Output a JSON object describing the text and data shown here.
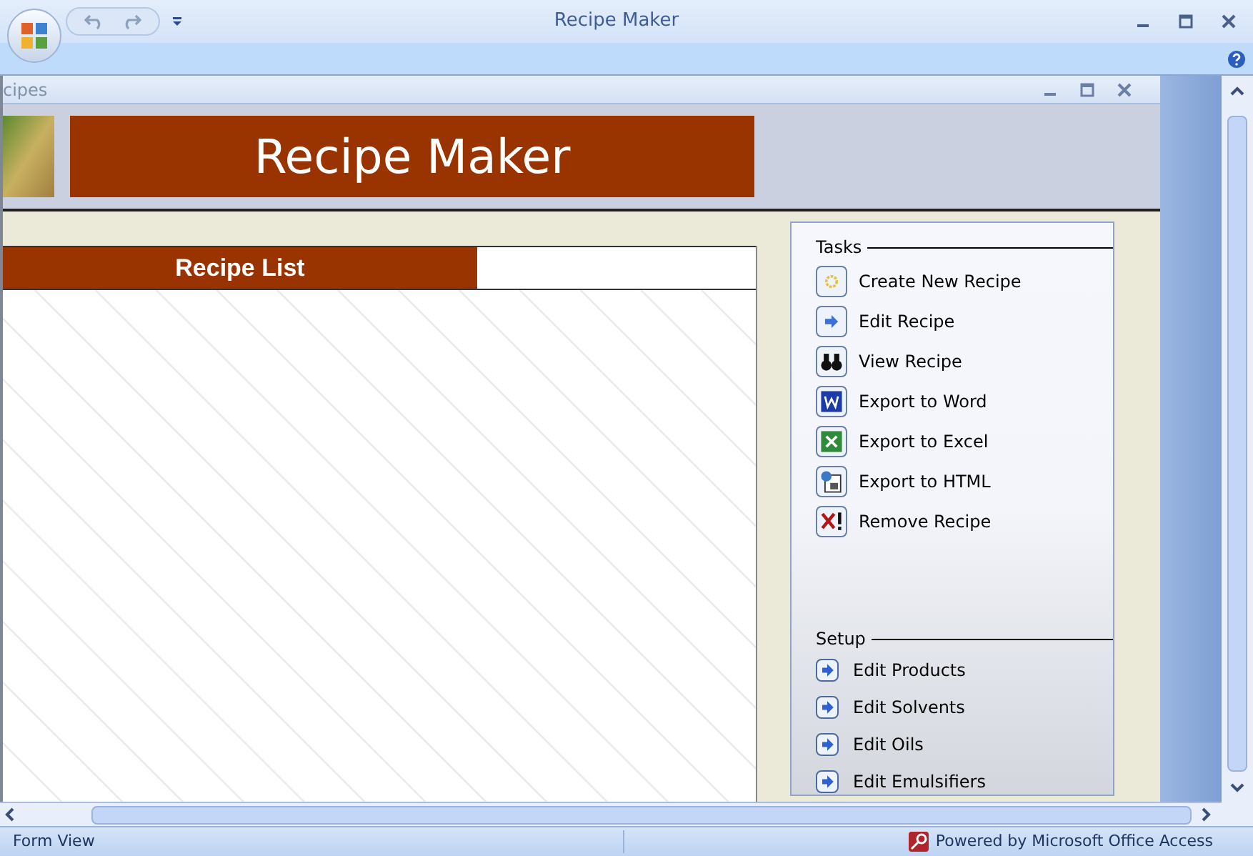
{
  "window": {
    "title": "Recipe Maker"
  },
  "form": {
    "title": "cipes",
    "banner": "Recipe Maker",
    "list": {
      "title": "Recipe List"
    },
    "tasks": {
      "title": "Tasks",
      "items": [
        {
          "label": "Create New Recipe",
          "kind": "new"
        },
        {
          "label": "Edit Recipe",
          "kind": "arrow"
        },
        {
          "label": "View Recipe",
          "kind": "binoculars"
        },
        {
          "label": "Export to Word",
          "kind": "word"
        },
        {
          "label": "Export to Excel",
          "kind": "excel"
        },
        {
          "label": "Export to HTML",
          "kind": "html"
        },
        {
          "label": "Remove Recipe",
          "kind": "remove"
        }
      ]
    },
    "setup": {
      "title": "Setup",
      "items": [
        {
          "label": "Edit Products"
        },
        {
          "label": "Edit Solvents"
        },
        {
          "label": "Edit Oils"
        },
        {
          "label": "Edit Emulsifiers"
        }
      ]
    }
  },
  "status_bar": {
    "view": "Form View",
    "brand": "Powered by Microsoft Office Access"
  }
}
